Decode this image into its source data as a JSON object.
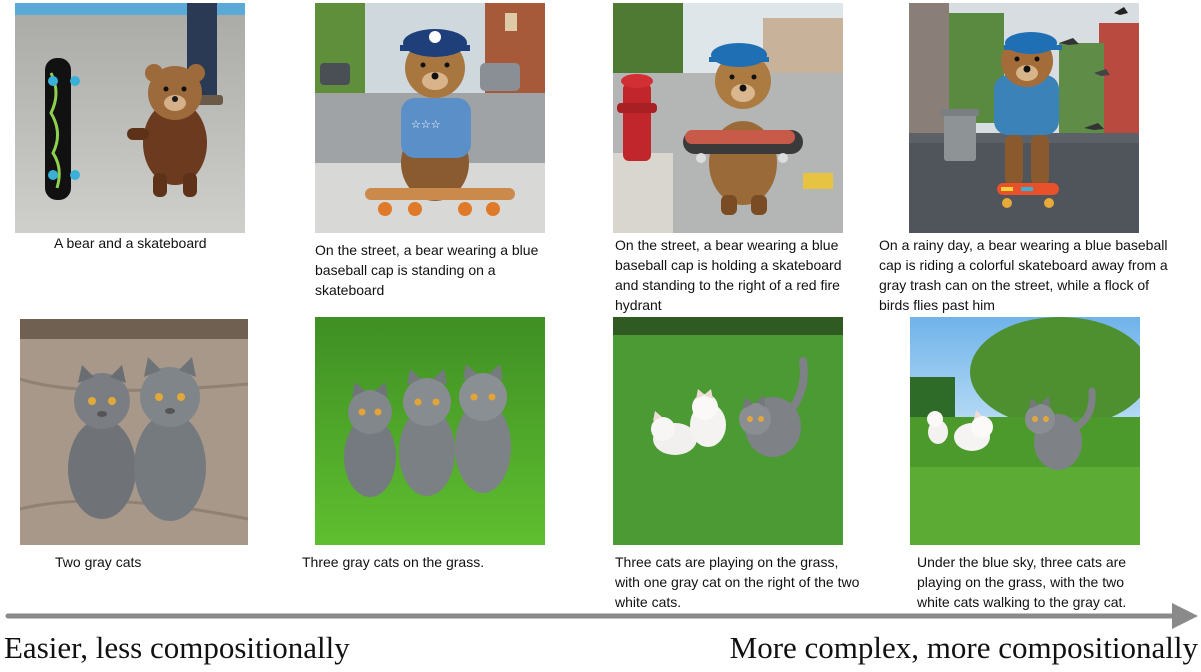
{
  "figure": {
    "rows": [
      {
        "name": "bear",
        "panels": [
          {
            "caption": "A bear and a skateboard",
            "scene": "bear-skateboard-plain"
          },
          {
            "caption": "On the street, a bear wearing a blue\nbaseball cap is standing on a\nskateboard",
            "scene": "bear-on-skateboard-street"
          },
          {
            "caption": "On the street, a bear wearing a blue\nbaseball cap is holding a skateboard\nand standing to the right of a red fire\nhydrant",
            "scene": "bear-hydrant-street"
          },
          {
            "caption": "On a rainy day, a bear wearing a blue baseball\ncap is riding a colorful skateboard away from a\ngray trash can on the street, while a flock of\nbirds flies past him",
            "scene": "bear-rainy-birds"
          }
        ]
      },
      {
        "name": "cats",
        "panels": [
          {
            "caption": "Two gray cats",
            "scene": "two-gray-cats"
          },
          {
            "caption": "Three gray cats on the grass.",
            "scene": "three-gray-cats-grass"
          },
          {
            "caption": "Three cats are playing on the grass,\nwith one gray cat on the right of the two\nwhite cats.",
            "scene": "three-cats-playing"
          },
          {
            "caption": "Under the blue sky, three cats are\nplaying on the grass, with the two\nwhite cats walking to the gray cat.",
            "scene": "three-cats-blue-sky"
          }
        ]
      }
    ],
    "axis": {
      "left_label": "Easier, less compositionally",
      "right_label": "More complex, more compositionally",
      "arrow_color": "#8a8a8a"
    }
  }
}
